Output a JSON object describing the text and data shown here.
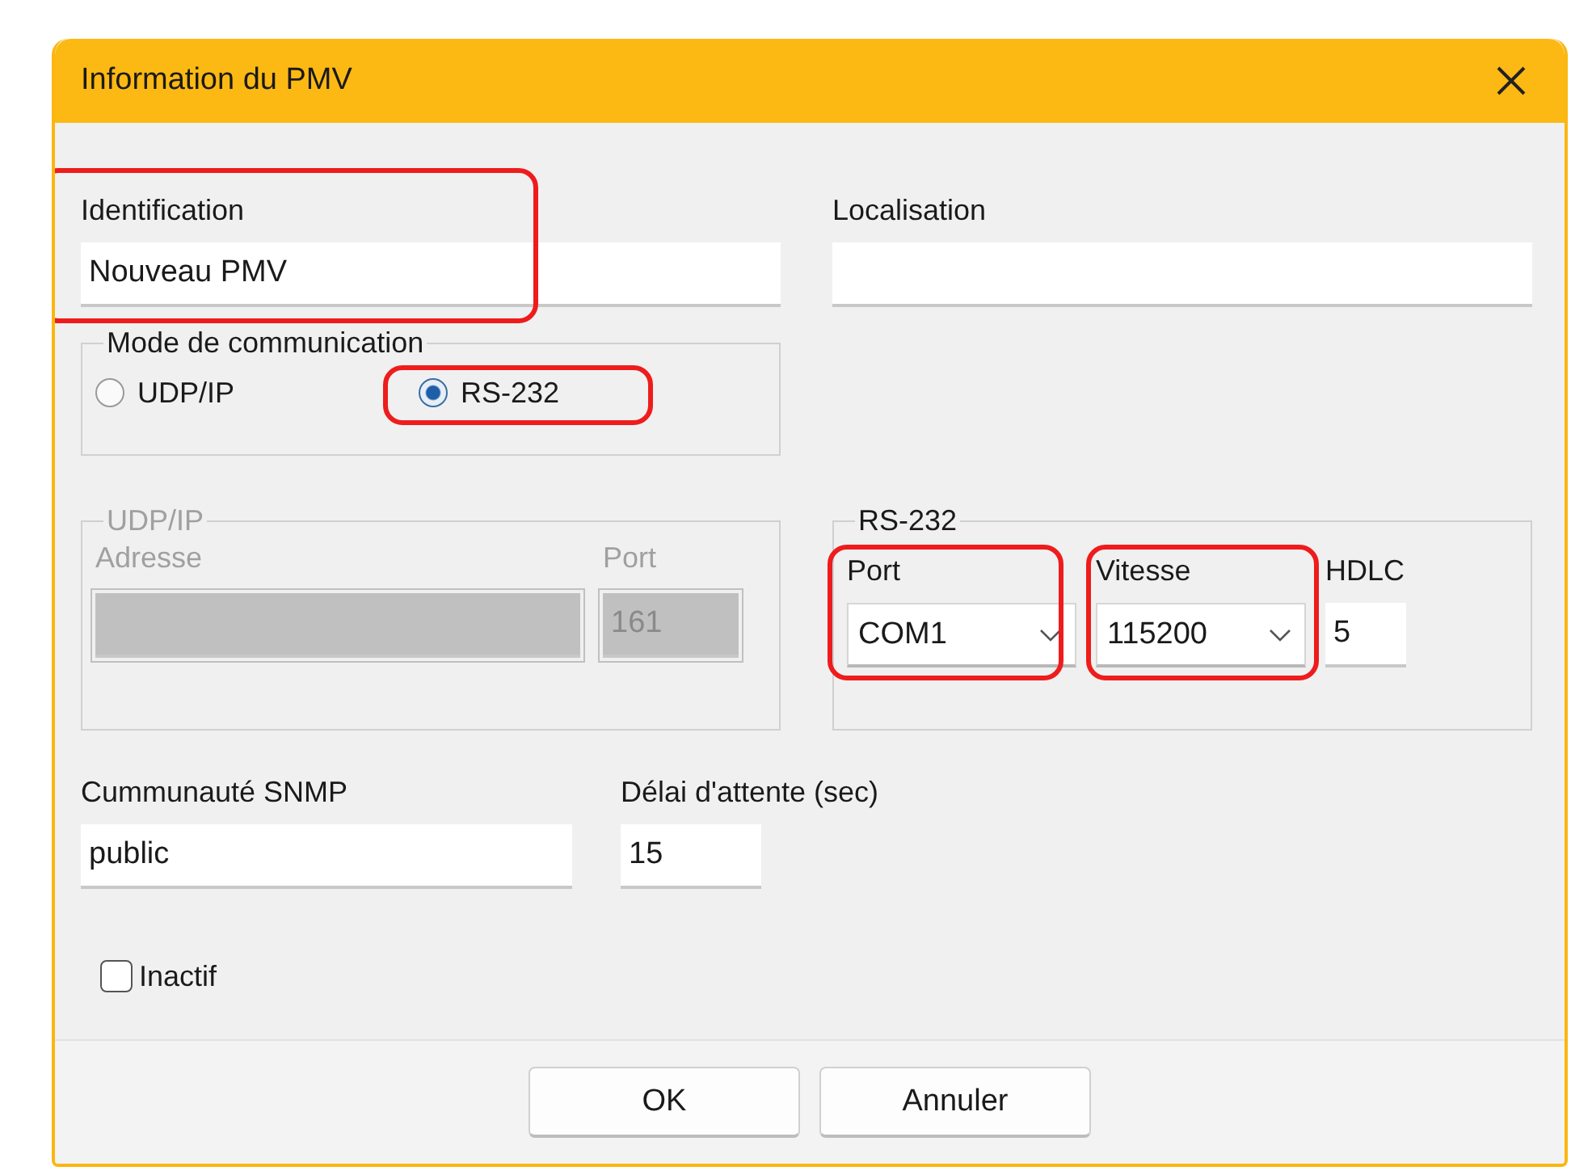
{
  "window": {
    "title": "Information du PMV"
  },
  "identification": {
    "label": "Identification",
    "value": "Nouveau PMV",
    "highlighted": true
  },
  "localisation": {
    "label": "Localisation"
  },
  "communication_mode": {
    "legend": "Mode de communication",
    "options": [
      {
        "label": "UDP/IP",
        "selected": false,
        "highlighted": false
      },
      {
        "label": "RS-232",
        "selected": true,
        "highlighted": true
      }
    ]
  },
  "udp_ip": {
    "legend": "UDP/IP",
    "disabled": true,
    "address": {
      "label": "Adresse"
    },
    "port": {
      "label": "Port",
      "value": "161"
    }
  },
  "rs232": {
    "legend": "RS-232",
    "port": {
      "label": "Port",
      "value": "COM1",
      "highlighted": true
    },
    "speed": {
      "label": "Vitesse",
      "value": "115200",
      "highlighted": true
    },
    "hdlc": {
      "label": "HDLC",
      "value": "5"
    }
  },
  "snmp_community": {
    "label": "Cummunauté SNMP",
    "value": "public"
  },
  "timeout": {
    "label": "Délai d'attente (sec)",
    "value": "15"
  },
  "inactive": {
    "label": "Inactif",
    "checked": false
  },
  "buttons": [
    "OK",
    "Annuler"
  ]
}
